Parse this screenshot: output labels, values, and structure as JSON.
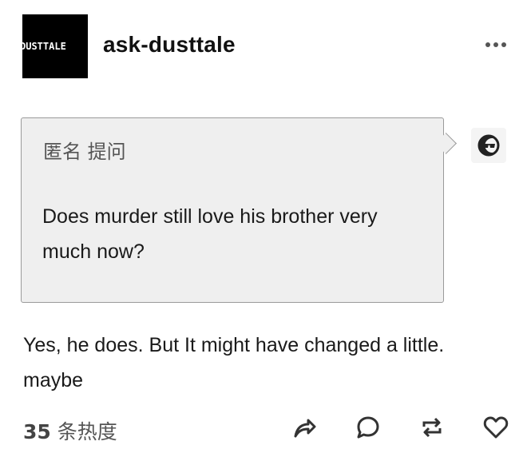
{
  "post": {
    "blog_name": "ask-dusttale",
    "avatar_text": "DUSTTALE",
    "asker_label": "匿名 提问",
    "question": "Does murder still love his brother very much now?",
    "answer": "Yes, he does. But It might have changed a little. maybe",
    "notes_count": "35",
    "notes_suffix": " 条热度"
  },
  "icons": {
    "more": "more-options-icon",
    "asker_avatar": "sunglasses-face-icon",
    "share": "share-icon",
    "reply": "reply-icon",
    "reblog": "reblog-icon",
    "like": "heart-icon"
  },
  "colors": {
    "ask_background": "#efefef",
    "ask_border": "#9a9a9a",
    "text": "#1a1a1a",
    "muted": "#555555"
  }
}
